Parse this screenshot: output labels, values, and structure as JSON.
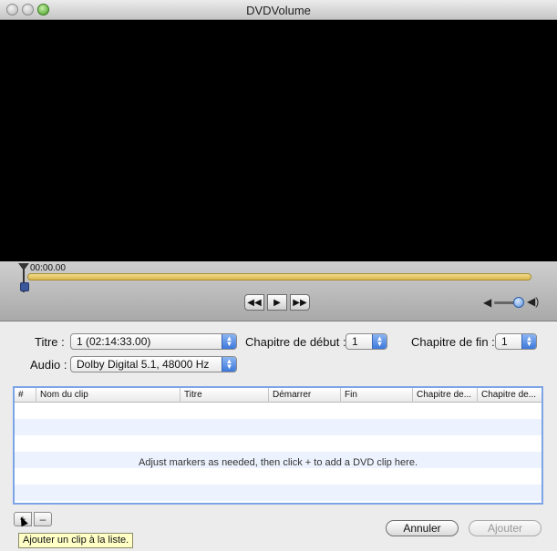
{
  "window": {
    "title": "DVDVolume"
  },
  "player": {
    "timecode": "00:00.00",
    "transport": {
      "rewind_icon": "rewind-icon",
      "play_icon": "play-icon",
      "forward_icon": "fast-forward-icon"
    },
    "rewind_glyph": "◀◀",
    "play_glyph": "▶",
    "forward_glyph": "▶▶",
    "volume_low_glyph": "◀",
    "volume_high_glyph": "◀)"
  },
  "form": {
    "title_label": "Titre :",
    "title_value": "1 (02:14:33.00)",
    "start_chapter_label": "Chapitre de début :",
    "start_chapter_value": "1",
    "end_chapter_label": "Chapitre de fin :",
    "end_chapter_value": "1",
    "audio_label": "Audio :",
    "audio_value": "Dolby Digital 5.1, 48000 Hz"
  },
  "table": {
    "columns": [
      "#",
      "Nom du clip",
      "Titre",
      "Démarrer",
      "Fin",
      "Chapitre de...",
      "Chapitre de..."
    ],
    "empty_message": "Adjust markers as needed, then click + to add a DVD clip here."
  },
  "list_controls": {
    "add_label": "+",
    "remove_label": "–"
  },
  "tooltip": "Ajouter un clip à la liste.",
  "buttons": {
    "cancel_label": "Annuler",
    "add_label": "Ajouter"
  },
  "colors": {
    "accent": "#3d78db",
    "timeline": "#e5c760"
  }
}
